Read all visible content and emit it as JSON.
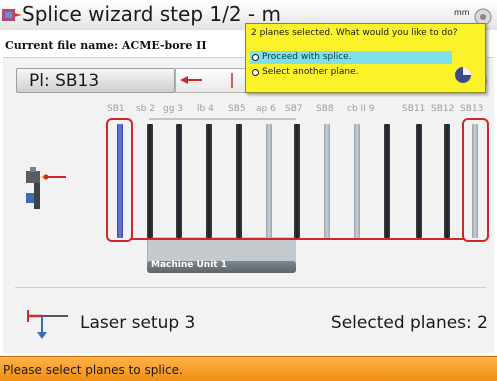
{
  "window": {
    "title": "Splice wizard step 1/2 - m",
    "file_label": "Current file name: ACME-bore II",
    "top_right_text": "mm"
  },
  "plane_field": {
    "label": "Pl: SB13"
  },
  "planes": [
    {
      "label": "SB1",
      "shade": "blue",
      "selected": true
    },
    {
      "label": "sb 2",
      "shade": "dark",
      "selected": false
    },
    {
      "label": "gg 3",
      "shade": "dark",
      "selected": false
    },
    {
      "label": "lb 4",
      "shade": "dark",
      "selected": false
    },
    {
      "label": "SB5",
      "shade": "dark",
      "selected": false
    },
    {
      "label": "ap 6",
      "shade": "light",
      "selected": false
    },
    {
      "label": "SB7",
      "shade": "dark",
      "selected": false
    },
    {
      "label": "SB8",
      "shade": "light",
      "selected": false
    },
    {
      "label": "cb II 9",
      "shade": "light",
      "selected": false
    },
    {
      "label": "",
      "shade": "dark",
      "selected": false
    },
    {
      "label": "SB11",
      "shade": "dark",
      "selected": false
    },
    {
      "label": "SB12",
      "shade": "dark",
      "selected": false
    },
    {
      "label": "SB13",
      "shade": "light",
      "selected": true
    }
  ],
  "machine_unit": {
    "label": "Machine Unit 1"
  },
  "footer": {
    "laser_label": "Laser setup 3",
    "selected_label": "Selected planes: 2"
  },
  "status": {
    "message": "Please select planes to splice."
  },
  "popup": {
    "question": "2 planes selected. What would you like to do?",
    "options": [
      {
        "label": "Proceed with splice.",
        "highlighted": true
      },
      {
        "label": "Select another plane.",
        "highlighted": false
      }
    ]
  },
  "colors": {
    "status_bar": "#f5a033",
    "popup_bg": "#fbf22a",
    "selection": "#cc2a2a",
    "highlight": "#7fe0e8"
  }
}
